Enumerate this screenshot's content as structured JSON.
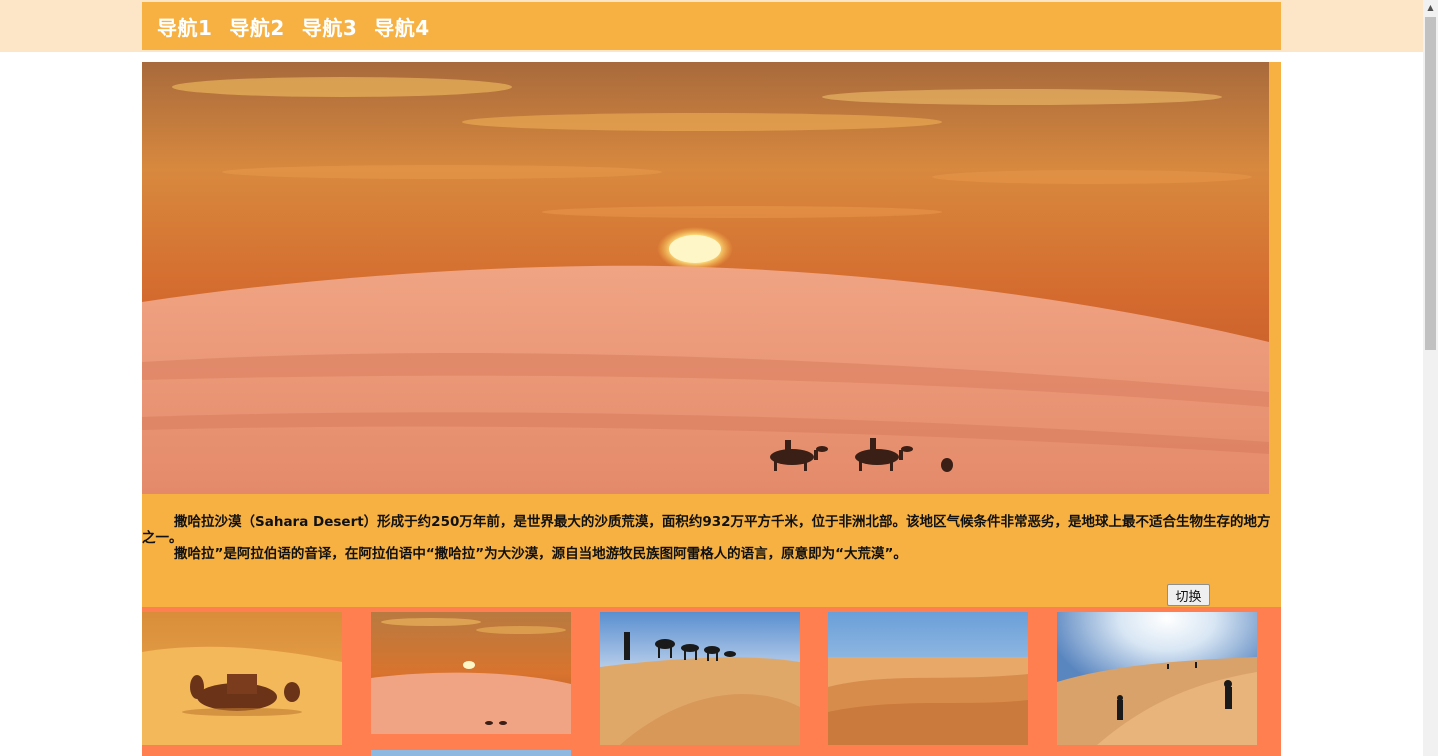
{
  "nav": {
    "items": [
      {
        "label": "导航1"
      },
      {
        "label": "导航2"
      },
      {
        "label": "导航3"
      },
      {
        "label": "导航4"
      }
    ]
  },
  "hero": {
    "icon": "desert-sunset-camels-image"
  },
  "description": {
    "paragraph1": "撒哈拉沙漠（Sahara Desert）形成于约250万年前，是世界最大的沙质荒漠，面积约932万平方千米，位于非洲北部。该地区气候条件非常恶劣，是地球上最不适合生物生存的地方之一。",
    "paragraph2": "撒哈拉”是阿拉伯语的音译，在阿拉伯语中“撒哈拉”为大沙漠，源自当地游牧民族图阿雷格人的语言，原意即为“大荒漠”。"
  },
  "controls": {
    "switch_label": "切换"
  },
  "thumbnails": [
    {
      "icon": "resting-camels-image"
    },
    {
      "icon": "desert-sunset-image"
    },
    {
      "icon": "camel-caravan-silhouette-image"
    },
    {
      "icon": "sand-dunes-image"
    },
    {
      "icon": "dune-climbers-image"
    }
  ],
  "colors": {
    "nav_bg": "#f6b142",
    "header_band": "#fde5c8",
    "main_bg": "#f6b142",
    "strip_bg": "#ff7f50"
  }
}
